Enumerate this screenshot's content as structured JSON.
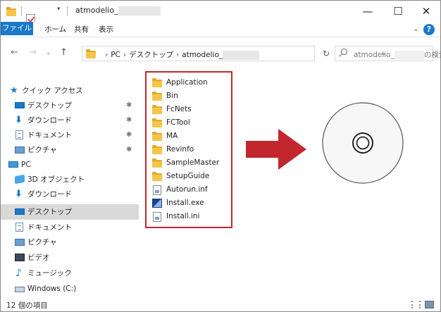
{
  "window": {
    "title_prefix": "atmodelio_",
    "controls": {
      "minimize": "—",
      "maximize": "☐",
      "close": "✕"
    }
  },
  "ribbon": {
    "tabs": [
      "ファイル",
      "ホーム",
      "共有",
      "表示"
    ],
    "help": "?"
  },
  "address": {
    "crumbs": [
      "PC",
      "デスクトップ",
      "atmodelio_"
    ],
    "search_placeholder_prefix": "atmodelio_",
    "search_placeholder_suffix": "の検索"
  },
  "nav_pane": {
    "items": [
      {
        "label": "クイック アクセス",
        "icon": "star-icon",
        "pinned": false
      },
      {
        "label": "デスクトップ",
        "icon": "desktop-icon",
        "pinned": true
      },
      {
        "label": "ダウンロード",
        "icon": "download-icon",
        "pinned": true
      },
      {
        "label": "ドキュメント",
        "icon": "document-icon",
        "pinned": true
      },
      {
        "label": "ピクチャ",
        "icon": "pictures-icon",
        "pinned": true
      },
      {
        "label": "PC",
        "icon": "pc-icon",
        "pinned": false
      },
      {
        "label": "3D オブジェクト",
        "icon": "3d-objects-icon",
        "pinned": false
      },
      {
        "label": "ダウンロード",
        "icon": "download-icon",
        "pinned": false
      },
      {
        "label": "デスクトップ",
        "icon": "desktop-icon",
        "pinned": false,
        "selected": true
      },
      {
        "label": "ドキュメント",
        "icon": "document-icon",
        "pinned": false
      },
      {
        "label": "ピクチャ",
        "icon": "pictures-icon",
        "pinned": false
      },
      {
        "label": "ビデオ",
        "icon": "video-icon",
        "pinned": false
      },
      {
        "label": "ミュージック",
        "icon": "music-icon",
        "pinned": false
      },
      {
        "label": "Windows (C:)",
        "icon": "drive-icon",
        "pinned": false
      }
    ]
  },
  "files": [
    {
      "name": "Application",
      "type": "folder"
    },
    {
      "name": "Bin",
      "type": "folder"
    },
    {
      "name": "FcNets",
      "type": "folder"
    },
    {
      "name": "FCTool",
      "type": "folder"
    },
    {
      "name": "MA",
      "type": "folder"
    },
    {
      "name": "Revinfo",
      "type": "folder"
    },
    {
      "name": "SampleMaster",
      "type": "folder"
    },
    {
      "name": "SetupGuide",
      "type": "folder"
    },
    {
      "name": "Autorun.inf",
      "type": "file"
    },
    {
      "name": "Install.exe",
      "type": "exe"
    },
    {
      "name": "Install.ini",
      "type": "file"
    }
  ],
  "status": {
    "item_count": "12 個の項目"
  },
  "colors": {
    "accent": "#1979ca",
    "highlight_border": "#c1272d",
    "arrow": "#c1272d"
  }
}
